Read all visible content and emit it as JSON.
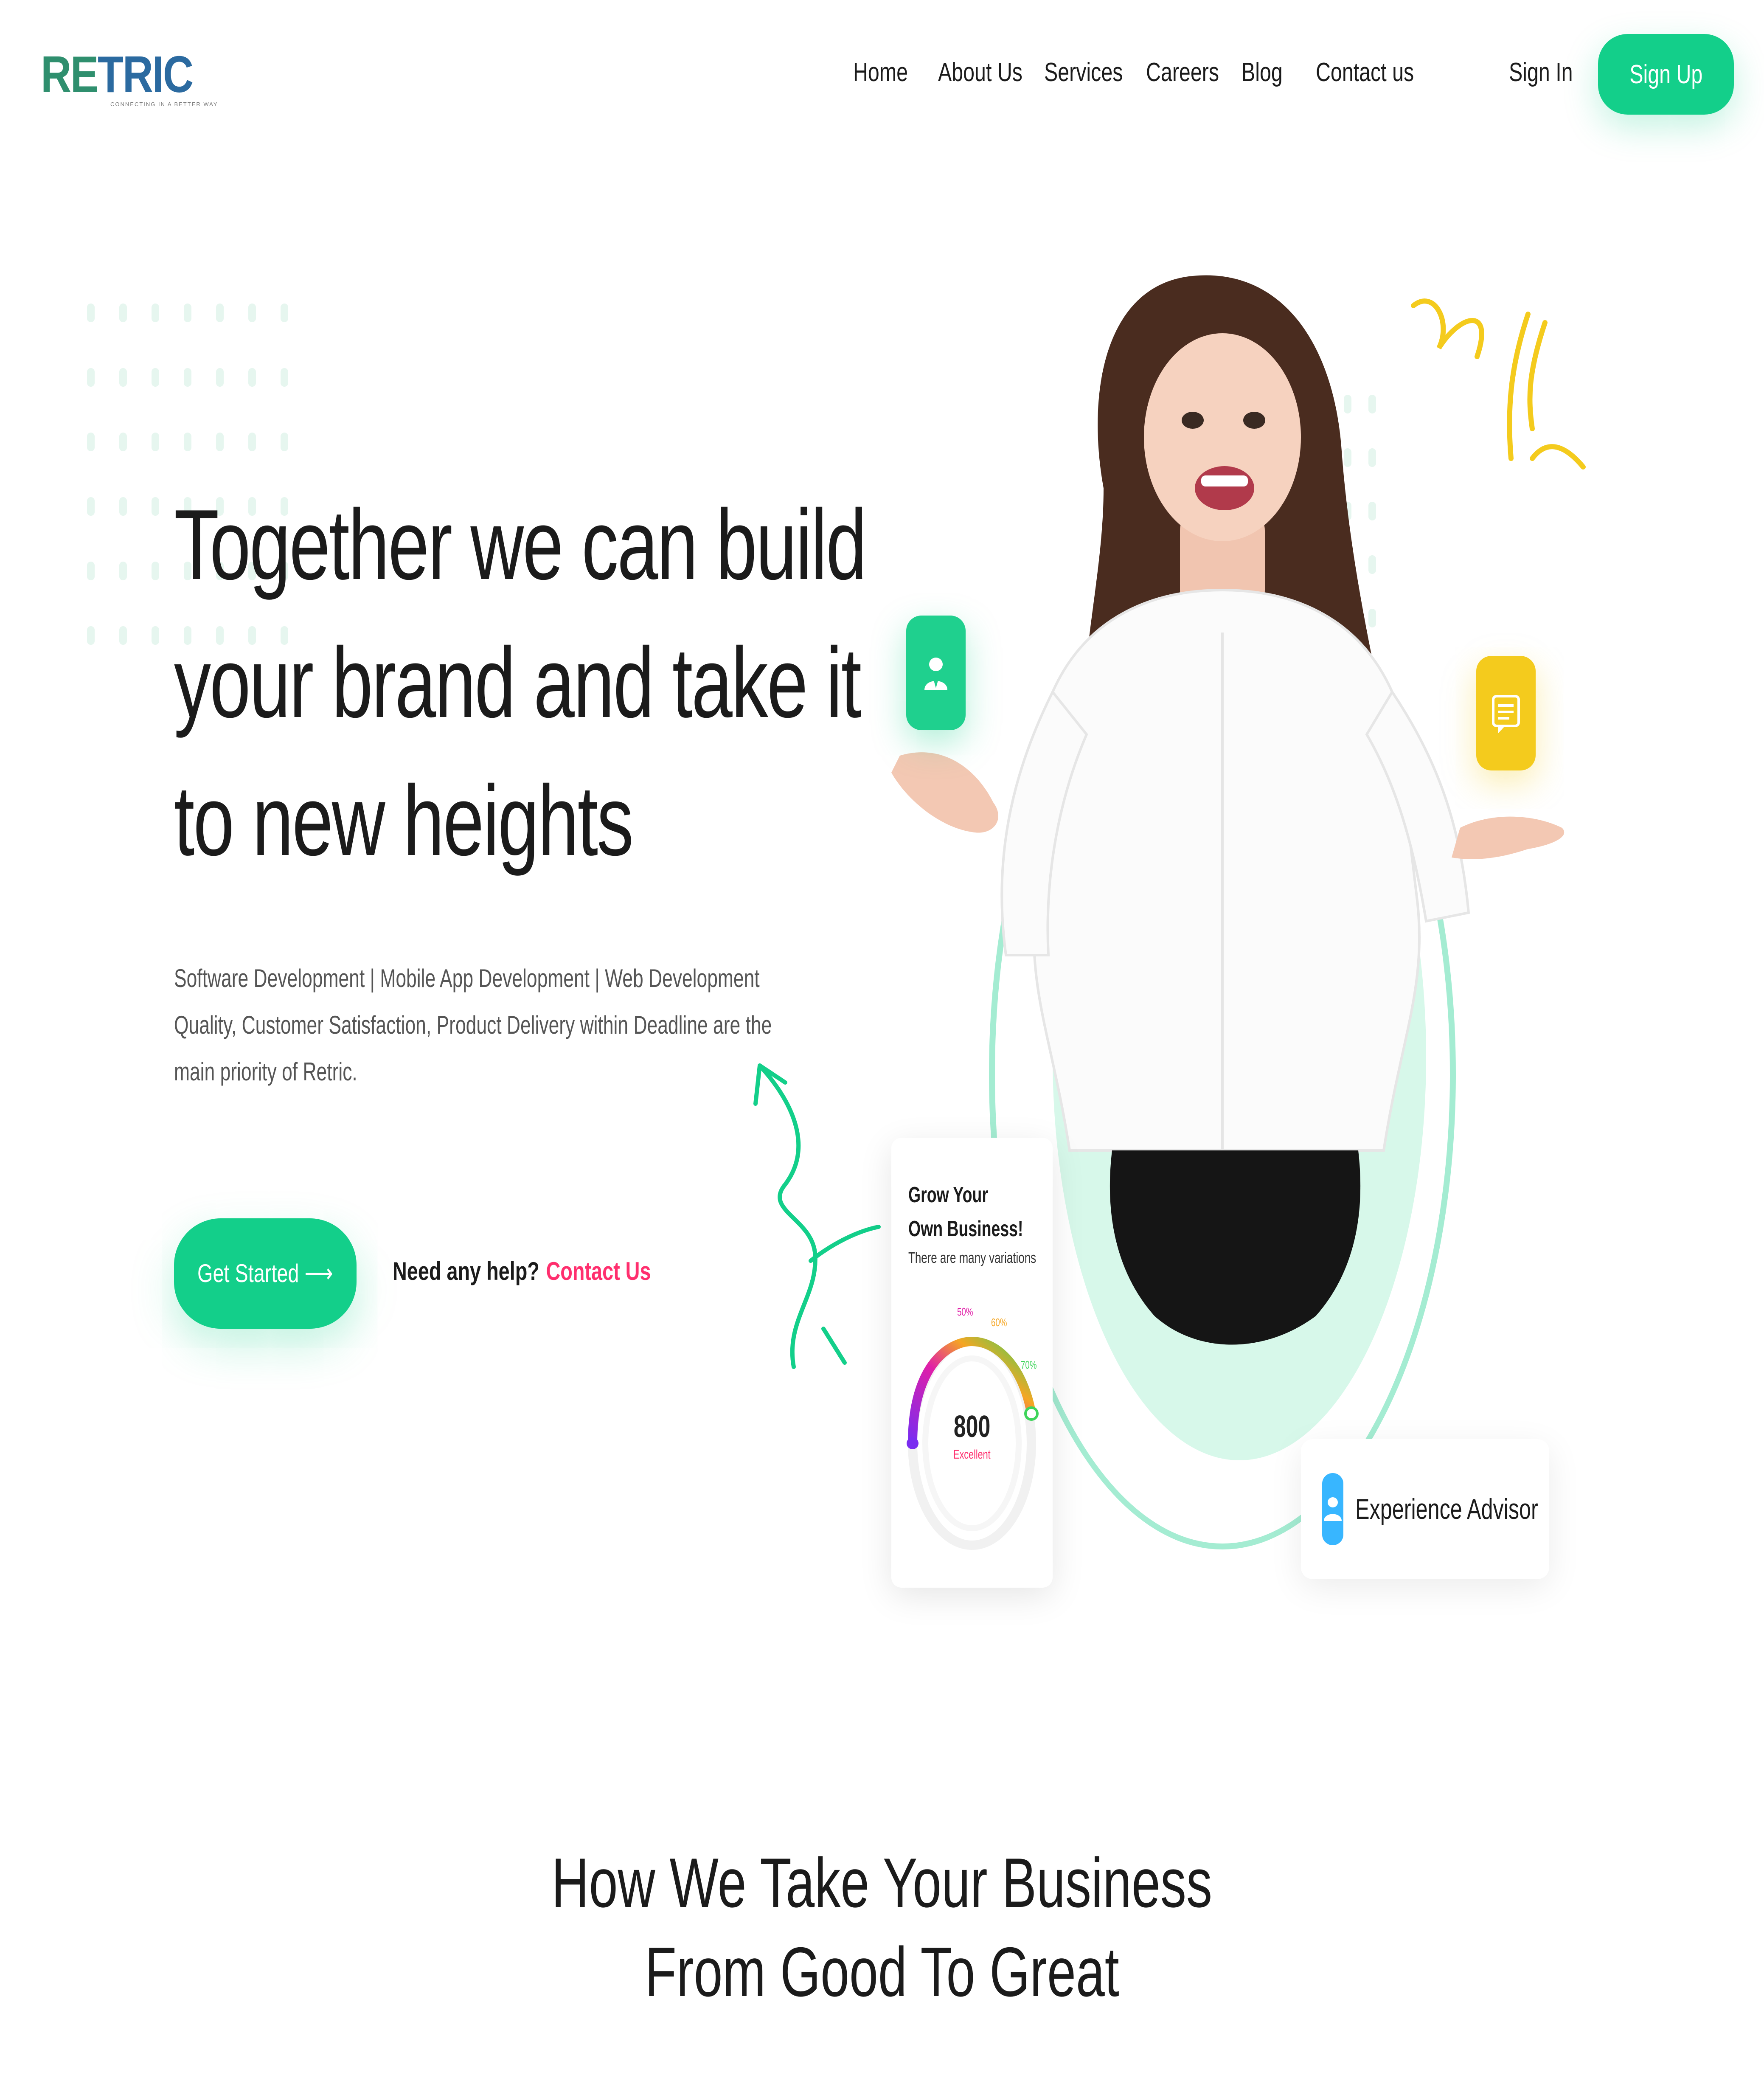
{
  "header": {
    "logo": {
      "brand_prefix": "RE",
      "brand_suffix": "TRIC",
      "tagline": "CONNECTING IN A BETTER WAY"
    },
    "nav": [
      {
        "label": "Home"
      },
      {
        "label": "About Us"
      },
      {
        "label": "Services"
      },
      {
        "label": "Careers"
      },
      {
        "label": "Blog"
      },
      {
        "label": "Contact us"
      }
    ],
    "sign_in_label": "Sign In",
    "sign_up_label": "Sign Up"
  },
  "hero": {
    "title_lines": [
      "Together we can build",
      "your brand and take it",
      "to new heights"
    ],
    "subtitle_lines": [
      "Software Development | Mobile App Development | Web Development",
      "Quality, Customer Satisfaction, Product Delivery within Deadline are the",
      "main priority of Retric."
    ],
    "cta_label": "Get Started ⟶",
    "help_text": "Need any help?",
    "help_link": "Contact Us"
  },
  "grow_card": {
    "title_line1": "Grow Your",
    "title_line2": "Own Business!",
    "description": "There are many variations",
    "gauge_value": "800",
    "gauge_label": "Excellent",
    "gauge_ticks": [
      "50%",
      "60%",
      "70%"
    ]
  },
  "advisor_card": {
    "label": "Experience Advisor",
    "icon": "user-icon"
  },
  "icon_cards": [
    {
      "icon": "user-badge-icon",
      "color": "#1fd08e"
    },
    {
      "icon": "chat-icon",
      "color": "#f4cb1d"
    }
  ],
  "section": {
    "title_line1": "How We Take Your Business",
    "title_line2": "From Good To Great"
  },
  "colors": {
    "accent": "#13cf8a",
    "link": "#ff2f6e",
    "ring": "#a4ecd2",
    "ring_fill": "#d7f8ea",
    "logo_green": "#2f8f6e",
    "logo_blue": "#2b6aa0"
  }
}
